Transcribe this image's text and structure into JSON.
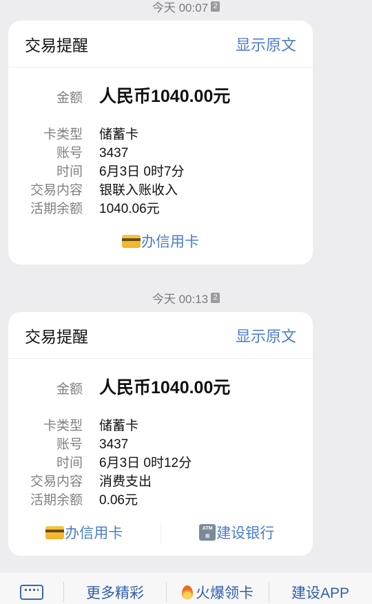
{
  "messages": [
    {
      "timestamp": "今天 00:07",
      "sim_badge": "2",
      "title": "交易提醒",
      "show_original": "显示原文",
      "amount_label": "金额",
      "amount": "人民币1040.00元",
      "fields": [
        {
          "label": "卡类型",
          "value": "储蓄卡"
        },
        {
          "label": "账号",
          "value": "3437"
        },
        {
          "label": "时间",
          "value": "6月3日 0时7分"
        },
        {
          "label": "交易内容",
          "value": "银联入账收入"
        },
        {
          "label": "活期余额",
          "value": "1040.06元"
        }
      ],
      "actions": [
        {
          "label": "办信用卡",
          "icon": "credit-card-icon"
        }
      ]
    },
    {
      "timestamp": "今天 00:13",
      "sim_badge": "2",
      "title": "交易提醒",
      "show_original": "显示原文",
      "amount_label": "金额",
      "amount": "人民币1040.00元",
      "fields": [
        {
          "label": "卡类型",
          "value": "储蓄卡"
        },
        {
          "label": "账号",
          "value": "3437"
        },
        {
          "label": "时间",
          "value": "6月3日 0时12分"
        },
        {
          "label": "交易内容",
          "value": "消费支出"
        },
        {
          "label": "活期余额",
          "value": "0.06元"
        }
      ],
      "actions": [
        {
          "label": "办信用卡",
          "icon": "credit-card-icon"
        },
        {
          "label": "建设银行",
          "icon": "atm-icon"
        }
      ]
    }
  ],
  "bottom_menu": {
    "keyboard_icon": "keyboard-icon",
    "items": [
      {
        "label": "更多精彩"
      },
      {
        "label": "火爆领卡",
        "icon": "fire-icon"
      },
      {
        "label": "建设APP"
      }
    ]
  },
  "colors": {
    "background": "#ededf0",
    "card": "#ffffff",
    "link": "#4a7bd1",
    "muted": "#808080"
  }
}
